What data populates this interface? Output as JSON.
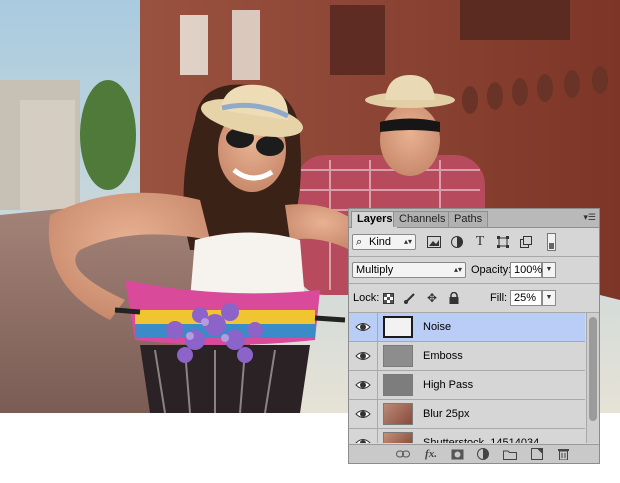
{
  "panel": {
    "tabs": [
      {
        "label": "Layers"
      },
      {
        "label": "Channels"
      },
      {
        "label": "Paths"
      }
    ],
    "filter": {
      "kind_label": "Kind"
    },
    "blend_mode": {
      "value": "Multiply"
    },
    "opacity": {
      "label": "Opacity:",
      "value": "100%"
    },
    "lock": {
      "label": "Lock:"
    },
    "fill": {
      "label": "Fill:",
      "value": "25%"
    },
    "layers": [
      {
        "name": "Noise",
        "selected": true
      },
      {
        "name": "Emboss",
        "selected": false
      },
      {
        "name": "High Pass",
        "selected": false
      },
      {
        "name": "Blur 25px",
        "selected": false
      },
      {
        "name": "Shutterstock_14514034",
        "selected": false
      }
    ],
    "footer_icons": [
      "link-icon",
      "fx-icon",
      "mask-icon",
      "adjustment-icon",
      "folder-icon",
      "new-layer-icon",
      "trash-icon"
    ]
  }
}
